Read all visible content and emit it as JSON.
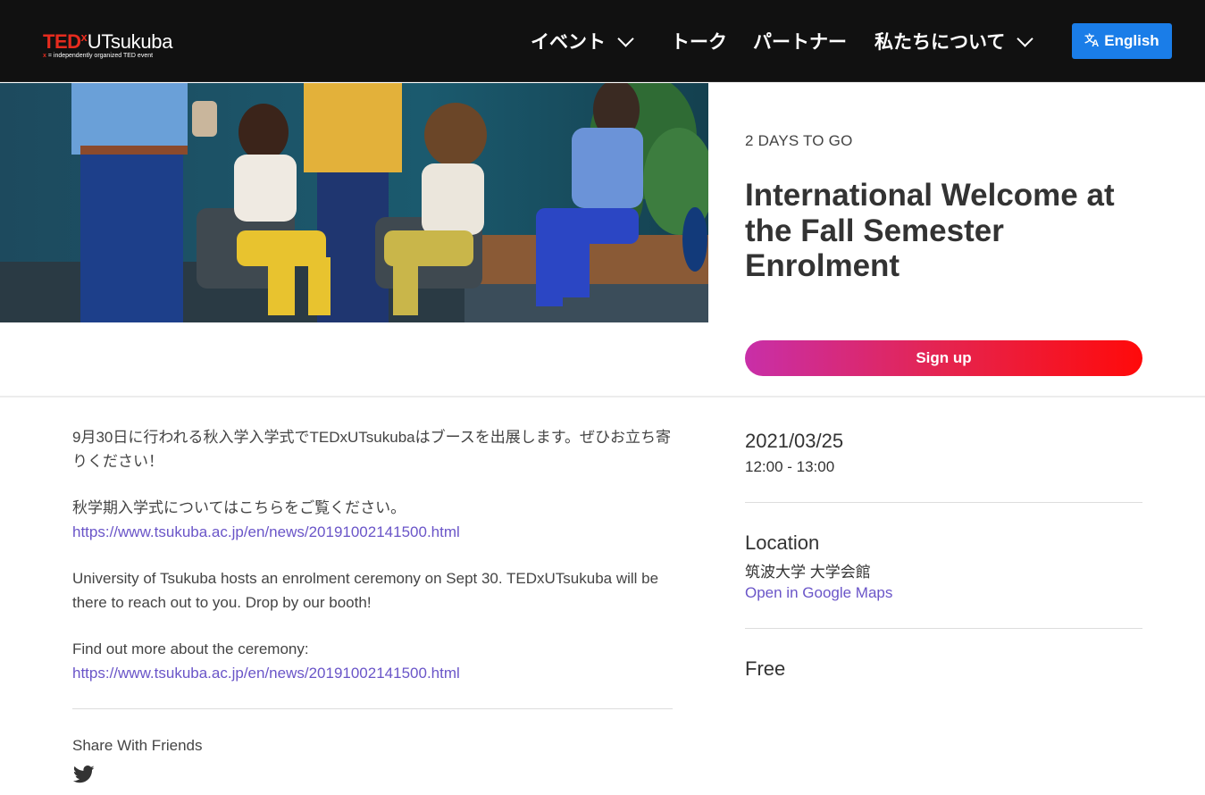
{
  "header": {
    "logo": {
      "tedx": "TED",
      "x": "x",
      "name": "UTsukuba",
      "sub_x": "x",
      "sub": " = independently organized TED event"
    },
    "nav": {
      "events": "イベント",
      "talks": "トーク",
      "partners": "パートナー",
      "about": "私たちについて"
    },
    "language_button": "English",
    "language_icon": "translate-icon"
  },
  "event": {
    "countdown": "2 DAYS TO GO",
    "title": "International Welcome at the Fall Semester Enrolment",
    "signup_label": "Sign up",
    "signup_gradient": [
      "#c82fa8",
      "#e5244f",
      "#ff0a0a"
    ]
  },
  "description": {
    "p1": "9月30日に行われる秋入学入学式でTEDxUTsukubaはブースを出展します。ぜひお立ち寄りください！",
    "p2_text": "秋学期入学式についてはこちらをご覧ください。",
    "p2_link": "https://www.tsukuba.ac.jp/en/news/20191002141500.html",
    "p3": "University of Tsukuba hosts an enrolment ceremony on Sept 30. TEDxUTsukuba will be there to reach out to you. Drop by our booth!",
    "p4_text": "Find out more about the ceremony: ",
    "p4_link": "https://www.tsukuba.ac.jp/en/news/20191002141500.html"
  },
  "share": {
    "label": "Share With Friends",
    "icon": "twitter-icon"
  },
  "details": {
    "date": "2021/03/25",
    "time": "12:00 - 13:00",
    "location_heading": "Location",
    "location_name": "筑波大学 大学会館",
    "map_link": "Open in Google Maps",
    "price": "Free"
  },
  "colors": {
    "header_bg": "#111111",
    "brand_red": "#e62b1e",
    "language_button": "#1a7de8",
    "link": "#6a55c8"
  }
}
